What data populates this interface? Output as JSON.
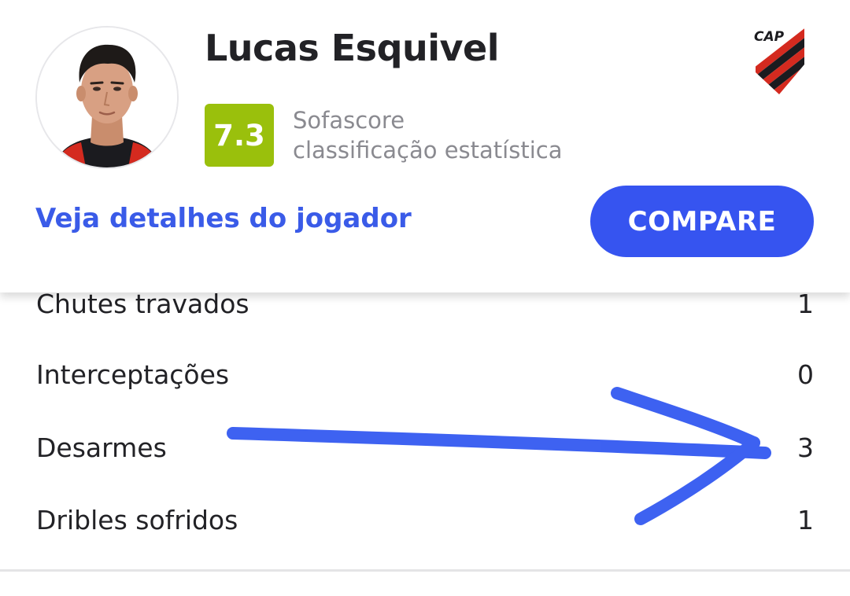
{
  "player": {
    "name": "Lucas Esquivel",
    "rating": "7.3",
    "rating_color": "#9ac00c",
    "rating_source_line1": "Sofascore",
    "rating_source_line2": "classificação estatística",
    "team_logo_text": "CAP"
  },
  "actions": {
    "details_link": "Veja detalhes do jogador",
    "compare_label": "COMPARE",
    "accent_color": "#3654f0"
  },
  "stats": [
    {
      "label": "Chutes travados",
      "value": "1"
    },
    {
      "label": "Interceptações",
      "value": "0"
    },
    {
      "label": "Desarmes",
      "value": "3"
    },
    {
      "label": "Dribles sofridos",
      "value": "1"
    }
  ],
  "annotation": {
    "type": "hand-drawn-arrow",
    "color": "#2f56f0",
    "points_to": "Desarmes"
  }
}
